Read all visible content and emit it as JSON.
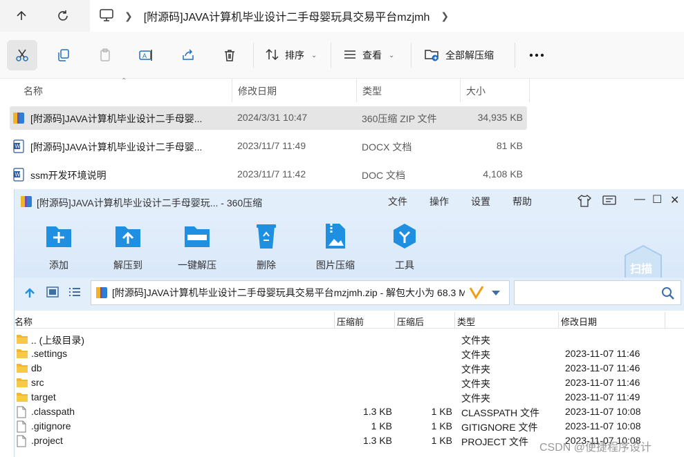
{
  "address_bar": {
    "path_segment": "[附源码]JAVA计算机毕业设计二手母婴玩具交易平台mzjmh"
  },
  "command_bar": {
    "sort_label": "排序",
    "view_label": "查看",
    "extract_all_label": "全部解压缩"
  },
  "explorer": {
    "columns": [
      "名称",
      "修改日期",
      "类型",
      "大小"
    ],
    "files": [
      {
        "name": "[附源码]JAVA计算机毕业设计二手母婴...",
        "date": "2024/3/31 10:47",
        "type": "360压缩 ZIP 文件",
        "size": "34,935 KB",
        "selected": true
      },
      {
        "name": "[附源码]JAVA计算机毕业设计二手母婴...",
        "date": "2023/11/7 11:49",
        "type": "DOCX 文档",
        "size": "81 KB",
        "selected": false
      },
      {
        "name": "ssm开发环境说明",
        "date": "2023/11/7 11:42",
        "type": "DOC 文档",
        "size": "4,108 KB",
        "selected": false
      }
    ]
  },
  "zip_window": {
    "title": "[附源码]JAVA计算机毕业设计二手母婴玩... - 360压缩",
    "menu": [
      "文件",
      "操作",
      "设置",
      "帮助"
    ],
    "toolbar": [
      "添加",
      "解压到",
      "一键解压",
      "删除",
      "图片压缩",
      "工具"
    ],
    "scan_label": "扫描",
    "path_text": "[附源码]JAVA计算机毕业设计二手母婴玩具交易平台mzjmh.zip - 解包大小为 68.3 M",
    "columns": [
      "名称",
      "压缩前",
      "压缩后",
      "类型",
      "修改日期"
    ],
    "rows": [
      {
        "name": ".. (上级目录)",
        "before": "",
        "after": "",
        "type": "文件夹",
        "date": "",
        "kind": "folder"
      },
      {
        "name": ".settings",
        "before": "",
        "after": "",
        "type": "文件夹",
        "date": "2023-11-07 11:46",
        "kind": "folder"
      },
      {
        "name": "db",
        "before": "",
        "after": "",
        "type": "文件夹",
        "date": "2023-11-07 11:46",
        "kind": "folder"
      },
      {
        "name": "src",
        "before": "",
        "after": "",
        "type": "文件夹",
        "date": "2023-11-07 11:46",
        "kind": "folder"
      },
      {
        "name": "target",
        "before": "",
        "after": "",
        "type": "文件夹",
        "date": "2023-11-07 11:49",
        "kind": "folder"
      },
      {
        "name": ".classpath",
        "before": "1.3 KB",
        "after": "1 KB",
        "type": "CLASSPATH 文件",
        "date": "2023-11-07 10:08",
        "kind": "file"
      },
      {
        "name": ".gitignore",
        "before": "1 KB",
        "after": "1 KB",
        "type": "GITIGNORE 文件",
        "date": "2023-11-07 10:08",
        "kind": "file"
      },
      {
        "name": ".project",
        "before": "1.3 KB",
        "after": "1 KB",
        "type": "PROJECT 文件",
        "date": "2023-11-07 10:08",
        "kind": "file"
      }
    ]
  },
  "watermark": "CSDN @便捷程序设计",
  "colors": {
    "accent_blue": "#1e8fe1",
    "selection": "#e5e5e5",
    "zip_bar": "#e3eefb"
  }
}
